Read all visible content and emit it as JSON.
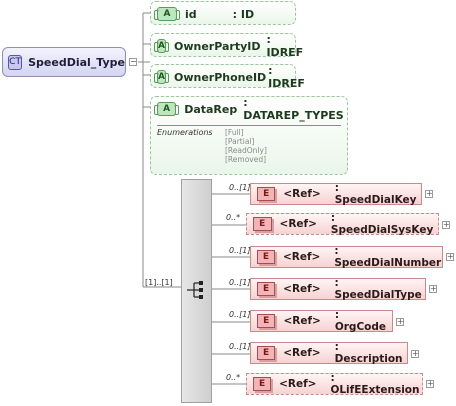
{
  "complex_type": {
    "badge": "CT",
    "name": "SpeedDial_Type",
    "sequence_cardinality": "[1]..[1]"
  },
  "attributes": [
    {
      "badge": "A",
      "name": "id",
      "type": ": ID"
    },
    {
      "badge": "A",
      "name": "OwnerPartyID",
      "type": ": IDREF"
    },
    {
      "badge": "A",
      "name": "OwnerPhoneID",
      "type": ": IDREF"
    },
    {
      "badge": "A",
      "name": "DataRep",
      "type": ": DATAREP_TYPES",
      "enum_label": "Enumerations",
      "enumerations": [
        "[Full]",
        "[Partial]",
        "[ReadOnly]",
        "[Removed]"
      ]
    }
  ],
  "elements": [
    {
      "badge": "E",
      "ref": "<Ref>",
      "type": ": SpeedDialKey",
      "cardinality": "0..[1]"
    },
    {
      "badge": "E",
      "ref": "<Ref>",
      "type": ": SpeedDialSysKey",
      "cardinality": "0..*"
    },
    {
      "badge": "E",
      "ref": "<Ref>",
      "type": ": SpeedDialNumber",
      "cardinality": "0..[1]"
    },
    {
      "badge": "E",
      "ref": "<Ref>",
      "type": ": SpeedDialType",
      "cardinality": "0..[1]"
    },
    {
      "badge": "E",
      "ref": "<Ref>",
      "type": ": OrgCode",
      "cardinality": "0..[1]"
    },
    {
      "badge": "E",
      "ref": "<Ref>",
      "type": ": Description",
      "cardinality": "0..[1]"
    },
    {
      "badge": "E",
      "ref": "<Ref>",
      "type": ": OLifEExtension",
      "cardinality": "0..*"
    }
  ],
  "expander_symbol": "+",
  "collapse_symbol": "−"
}
